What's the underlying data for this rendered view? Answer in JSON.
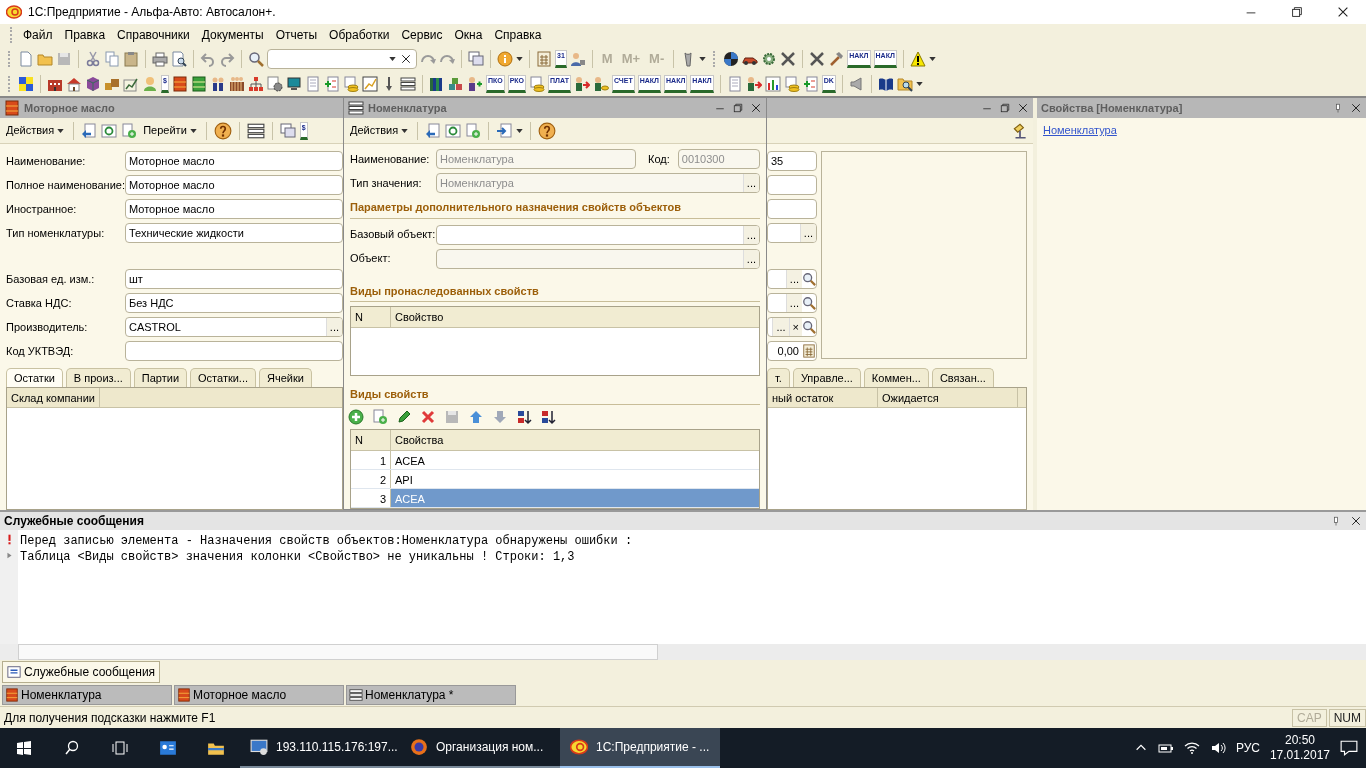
{
  "window": {
    "title": "1С:Предприятие - Альфа-Авто: Автосалон+."
  },
  "menu": [
    {
      "label": "Файл"
    },
    {
      "label": "Правка"
    },
    {
      "label": "Справочники"
    },
    {
      "label": "Документы"
    },
    {
      "label": "Отчеты"
    },
    {
      "label": "Обработки"
    },
    {
      "label": "Сервис"
    },
    {
      "label": "Окна"
    },
    {
      "label": "Справка"
    }
  ],
  "toolbar1": {
    "icon_labels": [
      "31",
      "НАКЛ",
      "НАКЛ"
    ],
    "memory_buttons": [
      {
        "label": "M",
        "disabled": true
      },
      {
        "label": "M+",
        "disabled": true
      },
      {
        "label": "M-",
        "disabled": true
      }
    ]
  },
  "toolbar2": {
    "icon_labels": [
      "$",
      "ПКО",
      "РКО",
      "ПЛАТ",
      "СЧЕТ",
      "НАКЛ",
      "НАКЛ",
      "НАКЛ",
      "DK"
    ]
  },
  "item_form": {
    "title": "Моторное масло",
    "menus": [
      {
        "label": "Действия",
        "dropdown": true
      },
      {
        "label": "Перейти",
        "dropdown": true
      }
    ],
    "icon_labels": [
      "$"
    ],
    "fields": [
      {
        "label": "Наименование:",
        "value": "Моторное масло"
      },
      {
        "label": "Полное наименование:",
        "value": "Моторное масло"
      },
      {
        "label": "Иностранное:",
        "value": "Моторное масло"
      },
      {
        "label": "Тип номенклатуры:",
        "value": "Технические жидкости"
      },
      {
        "label": "Базовая ед. изм.:",
        "value": "шт"
      },
      {
        "label": "Ставка НДС:",
        "value": "Без НДС"
      },
      {
        "label": "Производитель:",
        "value": "CASTROL",
        "choice_button": "..."
      },
      {
        "label": "Код УКТВЭД:"
      }
    ],
    "tabs": [
      {
        "label": "Остатки",
        "selected": true
      },
      {
        "label": "В произ...",
        "selected": false
      },
      {
        "label": "Партии",
        "selected": false
      },
      {
        "label": "Остатки...",
        "selected": false
      },
      {
        "label": "Ячейки",
        "selected": false
      }
    ],
    "columns": [
      "Склад компании"
    ],
    "right_fields": [
      {
        "kind": "text",
        "value": "35"
      },
      {
        "kind": "text"
      },
      {
        "kind": "text"
      },
      {
        "kind": "choice",
        "choice_button": "..."
      },
      {
        "kind": "lookup",
        "choice_button": "..."
      },
      {
        "kind": "lookup",
        "choice_button": "..."
      },
      {
        "kind": "lookup",
        "choice_button": "...",
        "clear_button": "×"
      },
      {
        "kind": "number",
        "value": "0,00"
      }
    ],
    "right_tabs": [
      {
        "label": "т.",
        "selected": false
      },
      {
        "label": "Управле...",
        "selected": false
      },
      {
        "label": "Коммен...",
        "selected": false
      },
      {
        "label": "Связан...",
        "selected": false
      }
    ],
    "right_columns": [
      "ный остаток",
      "Ожидается"
    ]
  },
  "dialog": {
    "title": "Номенклатура",
    "menus": [
      {
        "label": "Действия",
        "dropdown": true
      }
    ],
    "name": {
      "label": "Наименование:",
      "value": "Номенклатура",
      "disabled": true
    },
    "code": {
      "label": "Код:",
      "value": "0010300",
      "disabled": true
    },
    "value_type": {
      "label": "Тип значения:",
      "value": "Номенклатура",
      "choice_button": "...",
      "disabled": true
    },
    "section_title": "Параметры дополнительного назначения свойств объектов",
    "base_object": {
      "label": "Базовый объект:",
      "choice_button": "...",
      "disabled": false
    },
    "object": {
      "label": "Объект:",
      "choice_button": "...",
      "disabled": true
    },
    "inherited": {
      "title": "Виды пронаследованных свойств",
      "columns": [
        "N",
        "Свойство"
      ]
    },
    "properties": {
      "title": "Виды свойств",
      "columns": [
        "N",
        "Свойства"
      ],
      "rows": [
        {
          "n": "1",
          "value": "ACEA",
          "selected": false
        },
        {
          "n": "2",
          "value": "API",
          "selected": false
        },
        {
          "n": "3",
          "value": "ACEA",
          "selected": true
        }
      ]
    }
  },
  "properties_panel": {
    "title": "Свойства [Номенклатура]",
    "link": "Номенклатура"
  },
  "messages": {
    "title": "Служебные сообщения",
    "lines": [
      {
        "kind": "error",
        "text": "Перед записью элемента - Назначения свойств объектов:Номенклатура обнаружены ошибки :"
      },
      {
        "kind": "info",
        "text": "Таблица <Виды свойств> значения колонки <Свойство> не уникальны ! Строки: 1,3"
      }
    ]
  },
  "panel_tabs": [
    {
      "label": "Служебные сообщения",
      "selected": true
    }
  ],
  "window_tabs": [
    {
      "label": "Номенклатура",
      "kind": "catalog"
    },
    {
      "label": "Моторное масло",
      "kind": "catalog"
    },
    {
      "label": "Номенклатура *",
      "kind": "list"
    }
  ],
  "status_bar": {
    "hint": "Для получения подсказки нажмите F1",
    "indicators": [
      {
        "label": "CAP",
        "on": false
      },
      {
        "label": "NUM",
        "on": true
      }
    ]
  },
  "taskbar": {
    "items": [
      {
        "label": "193.110.115.176:197...",
        "kind": "remote",
        "selected": false
      },
      {
        "label": "Организация ном...",
        "kind": "browser",
        "selected": false
      },
      {
        "label": "1С:Предприятие - ...",
        "kind": "app",
        "selected": true
      }
    ],
    "language": "РУС",
    "time": "20:50",
    "date": "17.01.2017"
  }
}
